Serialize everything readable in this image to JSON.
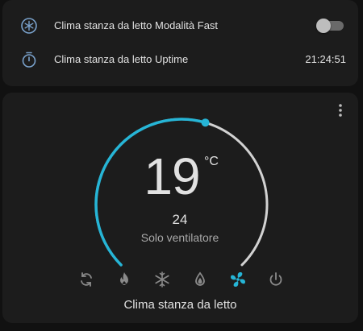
{
  "entities": [
    {
      "label": "Clima stanza da letto Modalità Fast",
      "icon": "snowflake-circle-icon",
      "toggle_on": false
    },
    {
      "label": "Clima stanza da letto Uptime",
      "icon": "timer-icon",
      "value": "21:24:51"
    }
  ],
  "thermostat": {
    "current_temp": "19",
    "unit": "°C",
    "target_temp": "24",
    "mode_label": "Solo ventilatore",
    "name": "Clima stanza da letto",
    "modes": [
      "auto-icon",
      "heat-flame-icon",
      "cool-snowflake-icon",
      "dry-water-icon",
      "fan-icon",
      "power-off-icon"
    ],
    "active_mode": "fan-icon",
    "target_fraction": 0.56
  },
  "colors": {
    "accent": "#26b5d6",
    "track": "#d2d2d2",
    "icon_muted": "#8a8a8a",
    "entity_icon": "#7aa2cc"
  }
}
